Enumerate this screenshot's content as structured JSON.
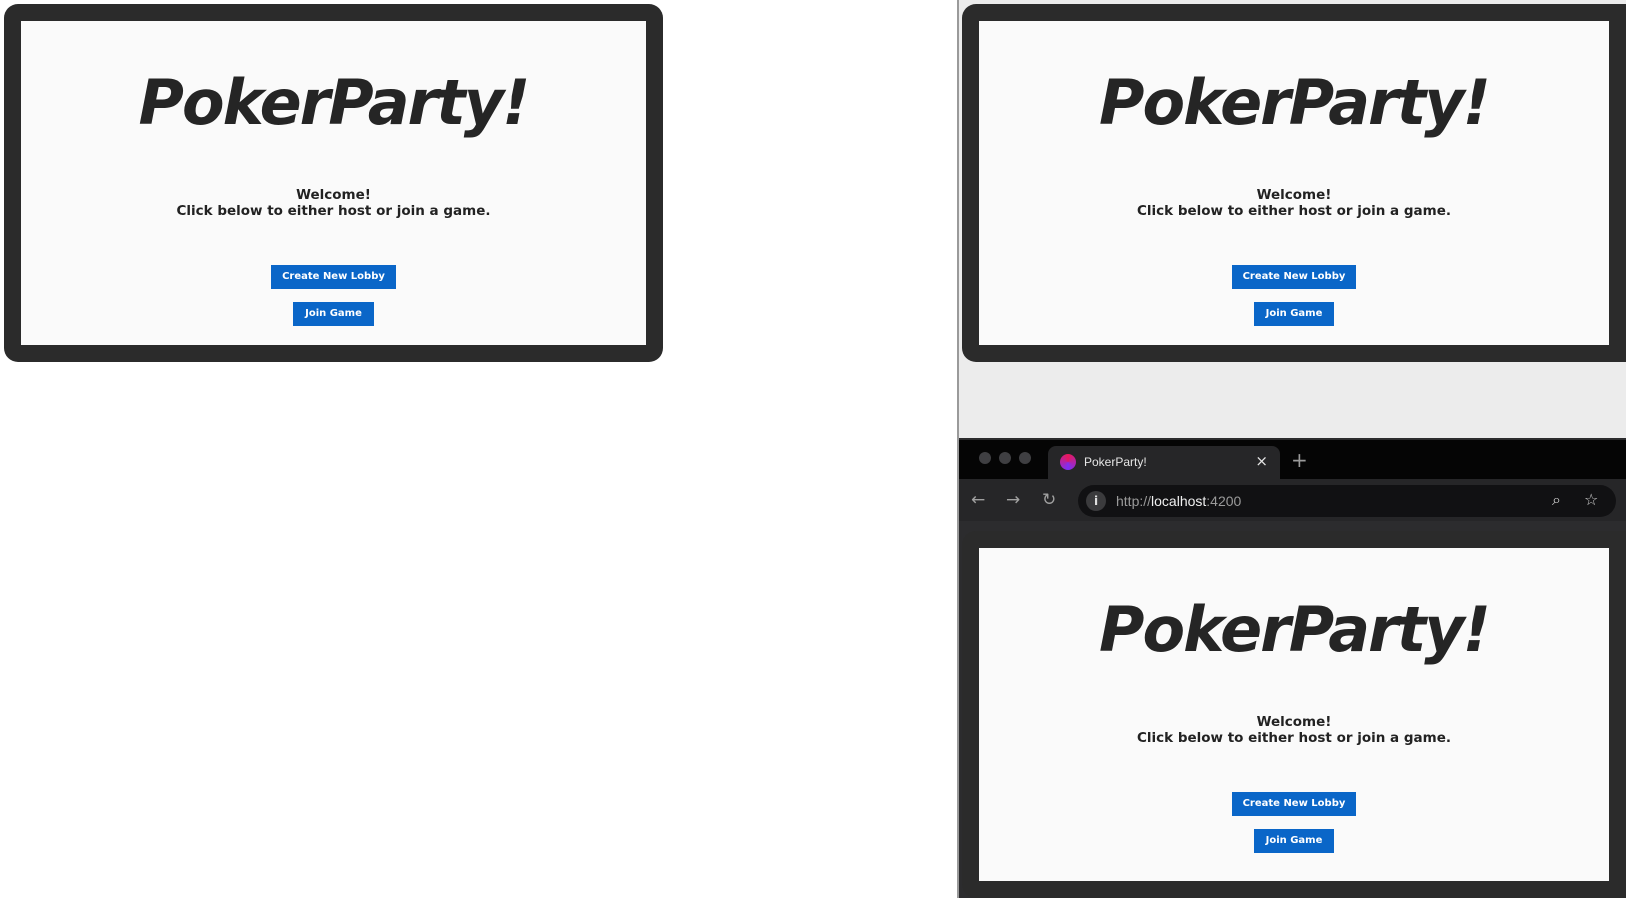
{
  "app": {
    "title": "PokerParty!",
    "welcome_line1": "Welcome!",
    "welcome_line2": "Click below to either host or join a game.",
    "create_button": "Create New Lobby",
    "join_button": "Join Game"
  },
  "browser": {
    "tab_title": "PokerParty!",
    "tab_close": "×",
    "new_tab": "+",
    "url_scheme": "http://",
    "url_host": "localhost",
    "url_port": ":4200",
    "info_glyph": "i",
    "back_glyph": "←",
    "forward_glyph": "→",
    "reload_glyph": "↻",
    "zoom_glyph": "⌕",
    "bookmark_glyph": "☆"
  },
  "colors": {
    "button": "#0a66c8",
    "frame": "#2b2b2b",
    "title": "#252525"
  }
}
